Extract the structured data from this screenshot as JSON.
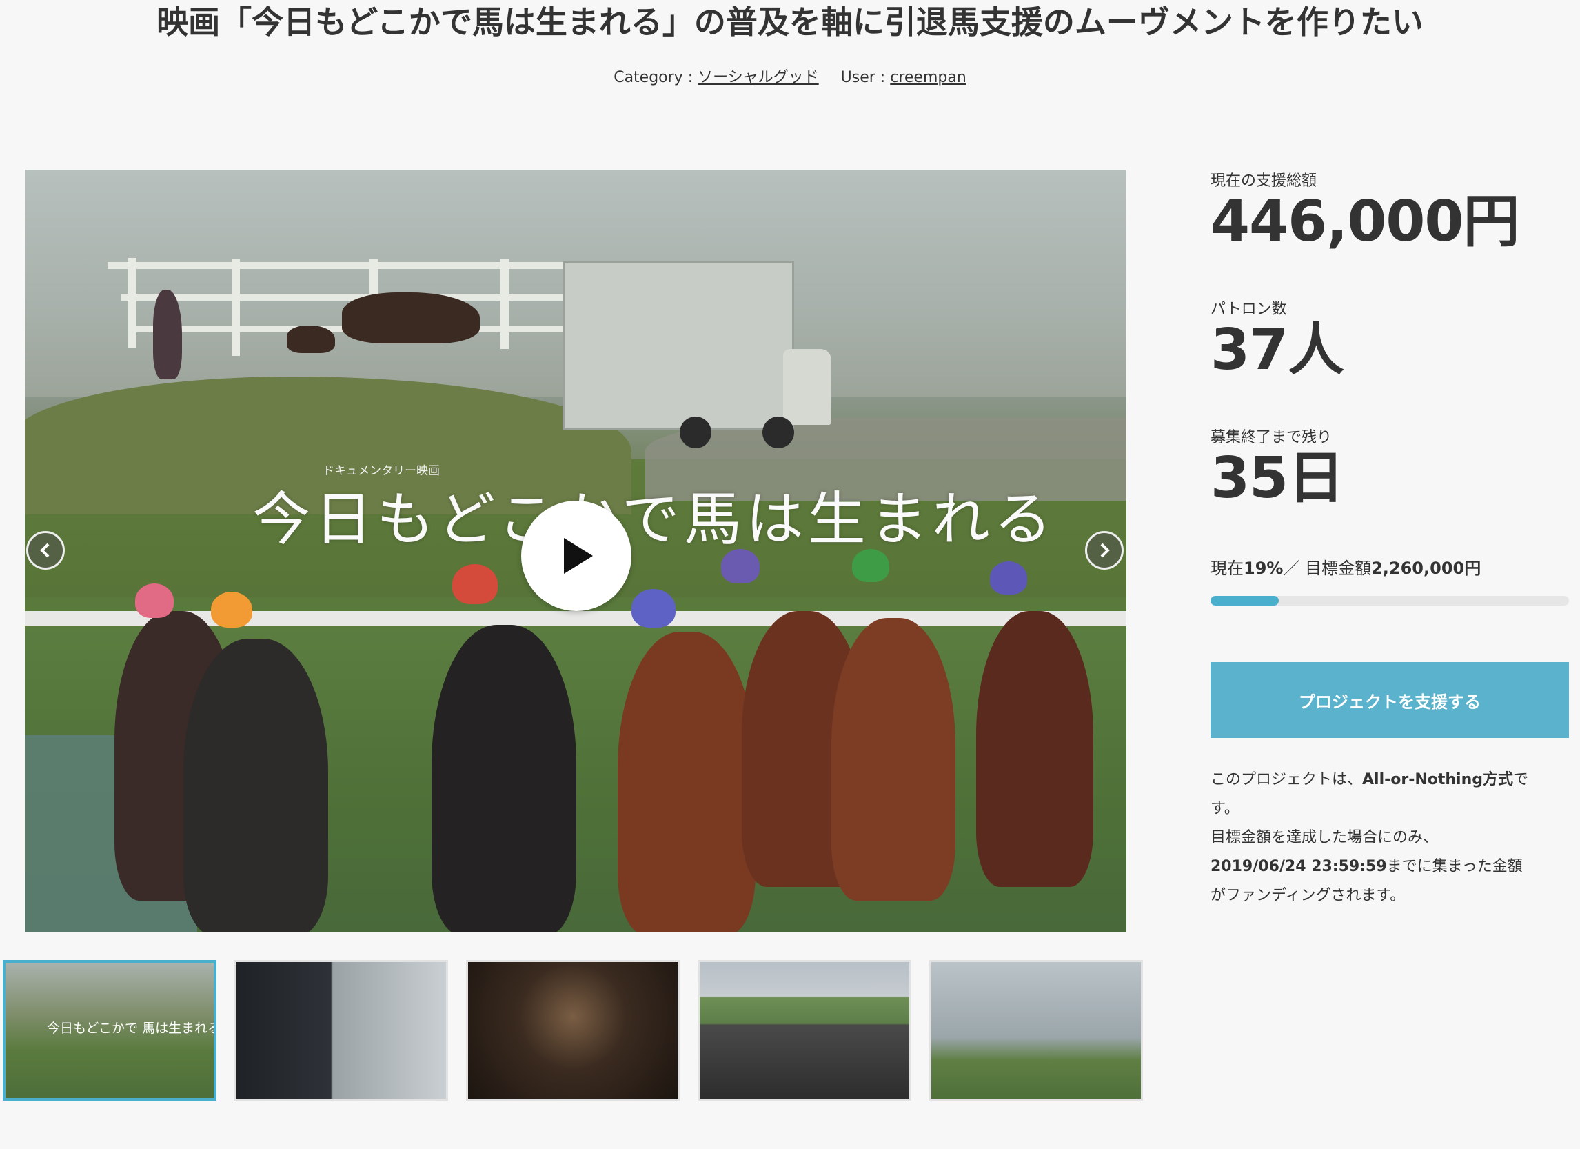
{
  "page": {
    "title": "映画「今日もどこかで馬は生まれる」の普及を軸に引退馬支援のムーヴメントを作りたい",
    "category_label": "Category :",
    "category_value": "ソーシャルグッド",
    "user_label": "User :",
    "user_value": "creempan"
  },
  "video": {
    "subtitle": "ドキュメンタリー映画",
    "film_title": "今日もどこかで馬は生まれる",
    "play_icon": "play-icon",
    "prev_icon": "chevron-left-icon",
    "next_icon": "chevron-right-icon"
  },
  "thumbnails": [
    {
      "label": "今日もどこかで 馬は生まれる",
      "active": true
    },
    {
      "label": "",
      "active": false
    },
    {
      "label": "",
      "active": false
    },
    {
      "label": "",
      "active": false
    },
    {
      "label": "",
      "active": false
    }
  ],
  "stats": {
    "total_label": "現在の支援総額",
    "total_value": "446,000円",
    "patrons_label": "パトロン数",
    "patrons_value": "37人",
    "remaining_label": "募集終了まで残り",
    "remaining_value": "35日"
  },
  "progress": {
    "current_prefix": "現在",
    "current_percent": "19%",
    "separator": "／ 目標金額",
    "goal_amount": "2,260,000円",
    "fraction": 0.19
  },
  "support_button": "プロジェクトを支援する",
  "note": {
    "line1_a": "このプロジェクトは、",
    "line1_b": "All-or-Nothing方式",
    "line1_c": "で",
    "line2": "す。",
    "line3": "目標金額を達成した場合にのみ、",
    "line4_a": "2019/06/24 23:59:59",
    "line4_b": "までに集まった金額",
    "line5": "がファンディングされます。"
  },
  "colors": {
    "accent": "#5ab2cc",
    "progress_fill": "#4aaecd",
    "text": "#333333",
    "background": "#f7f7f7"
  }
}
